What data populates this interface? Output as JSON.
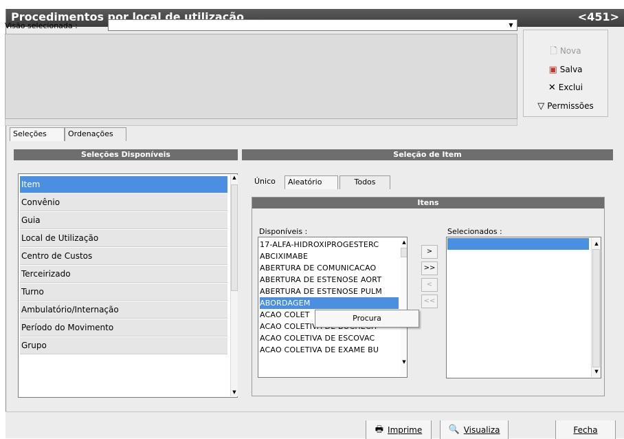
{
  "window": {
    "title": "Procedimentos por local de utilização",
    "code": "<451>"
  },
  "visao": {
    "label": "Visão selecionada  :",
    "value": ""
  },
  "side_buttons": {
    "nova": "Nova",
    "salva": "Salva",
    "exclui": "Exclui",
    "permissoes": "Permissões"
  },
  "main_tabs": [
    "Seleções",
    "Ordenações"
  ],
  "left_panel": {
    "header": "Seleções Disponíveis",
    "items": [
      "Item",
      "Convênio",
      "Guia",
      "Local de Utilização",
      "Centro de Custos",
      "Terceirizado",
      "Turno",
      "Ambulatório/Internação",
      "Período do Movimento",
      "Grupo"
    ],
    "selected_index": 0
  },
  "right_panel": {
    "header": "Seleção de Item",
    "sub_tabs": [
      "Único",
      "Aleatório",
      "Todos"
    ],
    "active_sub_tab": "Aleatório",
    "itens_header": "Itens",
    "disponiveis_label": "Disponíveis :",
    "selecionados_label": "Selecionados :",
    "disponiveis": [
      "17-ALFA-HIDROXIPROGESTERC",
      "ABCIXIMABE",
      "ABERTURA DE COMUNICACAO",
      "ABERTURA DE ESTENOSE AORT",
      "ABERTURA DE ESTENOSE PULM",
      "ABORDAGEM",
      "ACAO COLET",
      "ACAO COLETIVA DE BOCHECH",
      "ACAO COLETIVA DE ESCOVAC",
      "ACAO COLETIVA DE EXAME BU"
    ],
    "disponiveis_selected_index": 5,
    "transfer_buttons": [
      ">",
      ">>",
      "<",
      "<<"
    ]
  },
  "context_menu": {
    "item": "Procura"
  },
  "bottom": {
    "imprime": "Imprime",
    "visualiza": "Visualiza",
    "fecha": "Fecha"
  },
  "colors": {
    "titlebar": "#4a4a4a",
    "header": "#6e6e6e",
    "selection": "#4a8fe0"
  }
}
